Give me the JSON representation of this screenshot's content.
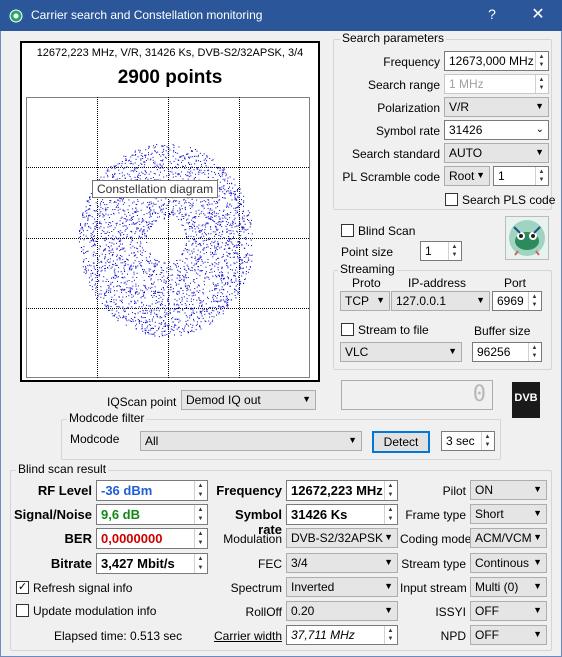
{
  "window": {
    "title": "Carrier search and Constellation monitoring",
    "help": "?",
    "close": "✕"
  },
  "plot": {
    "header": "12672,223 MHz, V/R, 31426 Ks, DVB-S2/32APSK, 3/4",
    "points_text": "2900 points",
    "tooltip": "Constellation diagram",
    "point_color": "#0000cc",
    "n_points": 2900
  },
  "search": {
    "title": "Search parameters",
    "frequency_label": "Frequency",
    "frequency_value": "12673,000 MHz",
    "range_label": "Search range",
    "range_value": "1 MHz",
    "polarization_label": "Polarization",
    "polarization_value": "V/R",
    "symbol_rate_label": "Symbol rate",
    "symbol_rate_value": "31426",
    "standard_label": "Search standard",
    "standard_value": "AUTO",
    "pls_label": "PL Scramble code",
    "pls_mode": "Root",
    "pls_value": "1",
    "search_pls_label": "Search PLS code"
  },
  "blind": {
    "label": "Blind Scan",
    "point_size_label": "Point size",
    "point_size_value": "1"
  },
  "streaming": {
    "title": "Streaming",
    "proto_label": "Proto",
    "ip_label": "IP-address",
    "port_label": "Port",
    "proto_value": "TCP",
    "ip_value": "127.0.0.1",
    "port_value": "6969",
    "stream_to_file_label": "Stream to file",
    "buffer_label": "Buffer size",
    "player_value": "VLC",
    "buffer_value": "96256"
  },
  "lcd": {
    "value": "0"
  },
  "logo": {
    "text": "DVB"
  },
  "iqscan": {
    "label": "IQScan point",
    "value": "Demod IQ out"
  },
  "modcod": {
    "title": "Modcode filter",
    "label": "Modcode",
    "value": "All",
    "detect": "Detect",
    "interval": "3 sec"
  },
  "result": {
    "title": "Blind scan result",
    "rf_label": "RF Level",
    "rf_value": "-36 dBm",
    "sn_label": "Signal/Noise",
    "sn_value": "9,6 dB",
    "ber_label": "BER",
    "ber_value": "0,0000000",
    "bitrate_label": "Bitrate",
    "bitrate_value": "3,427 Mbit/s",
    "refresh_label": "Refresh signal info",
    "update_label": "Update modulation info",
    "elapsed": "Elapsed time: 0.513 sec",
    "freq_label": "Frequency",
    "freq_value": "12672,223 MHz",
    "sr_label": "Symbol rate",
    "sr_value": "31426 Ks",
    "modulation_label": "Modulation",
    "modulation_value": "DVB-S2/32APSK",
    "fec_label": "FEC",
    "fec_value": "3/4",
    "spectrum_label": "Spectrum",
    "spectrum_value": "Inverted",
    "rolloff_label": "RollOff",
    "rolloff_value": "0.20",
    "cw_label": "Carrier width",
    "cw_value": "37,711 MHz",
    "pilot_label": "Pilot",
    "pilot_value": "ON",
    "frame_label": "Frame type",
    "frame_value": "Short",
    "coding_label": "Coding mode",
    "coding_value": "ACM/VCM",
    "stype_label": "Stream type",
    "stype_value": "Continous",
    "input_label": "Input stream",
    "input_value": "Multi (0)",
    "issyi_label": "ISSYI",
    "issyi_value": "OFF",
    "npd_label": "NPD",
    "npd_value": "OFF",
    "colors": {
      "rf": "#1f5fd6",
      "sn": "#138a13",
      "ber": "#d00000"
    }
  }
}
